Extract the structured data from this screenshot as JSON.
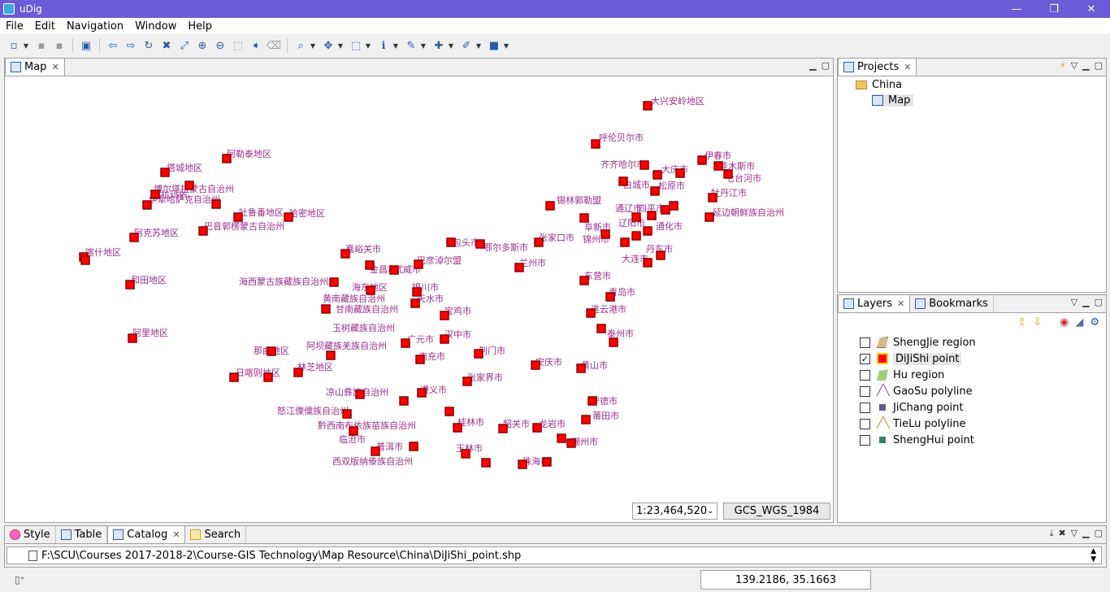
{
  "window": {
    "title": "uDig",
    "min_glyph": "—",
    "restore_glyph": "❐",
    "close_glyph": "✕"
  },
  "menu": [
    "File",
    "Edit",
    "Navigation",
    "Window",
    "Help"
  ],
  "map_view": {
    "tab_label": "Map",
    "scale": "1:23,464,520",
    "crs": "GCS_WGS_1984",
    "point_color": "#ff0000",
    "point_border": "#8b0000",
    "label_color": "#9b2d8e",
    "labels": [
      "大兴安岭地区",
      "呼伦贝尔市",
      "齐齐哈尔市",
      "大庆市",
      "伊春市",
      "佳木斯市",
      "七台河市",
      "牡丹江市",
      "松原市",
      "白城市",
      "延边朝鲜族自治州",
      "锡林郭勒盟",
      "阿勒泰地区",
      "塔城地区",
      "博尔塔拉蒙古自治州",
      "克拉玛依",
      "伊犁哈萨克自治州",
      "吐鲁番地区",
      "哈密地区",
      "巴音郭楞蒙古自治州",
      "阿克苏地区",
      "喀什地区",
      "和田地区",
      "阿里地区",
      "嘉峪关市",
      "金昌市",
      "武威市",
      "海西蒙古族藏族自治州",
      "海东地区",
      "黄南藏族自治州",
      "甘南藏族自治州",
      "玉树藏族自治州",
      "阿坝藏族羌族自治州",
      "那曲地区",
      "日喀则地区",
      "林芝地区",
      "凉山彝族自治州",
      "怒江傈僳族自治州",
      "黔西南布依族苗族自治州",
      "临沧市",
      "普洱市",
      "西双版纳傣族自治州",
      "包头市",
      "鄂尔多斯市",
      "张家口市",
      "锦州市",
      "大连市",
      "丹东市",
      "东营市",
      "青岛市",
      "连云港市",
      "泰州市",
      "宁德市",
      "莆田市",
      "潮州市",
      "珠海市",
      "桂林市",
      "韶关市",
      "龙岩市",
      "玉林市",
      "遵义市",
      "荆门市",
      "安庆市",
      "黄山市",
      "张家界市",
      "通辽市",
      "四平市",
      "通化市",
      "辽阳市",
      "银川市",
      "天水市",
      "广元市",
      "南充市",
      "宝鸡市",
      "汉中市",
      "阜新市",
      "巴彦淖尔盟",
      "兰州市"
    ]
  },
  "projects": {
    "tab_label": "Projects",
    "tree": [
      "China",
      "Map"
    ]
  },
  "layers": {
    "tab_label": "Layers",
    "bookmarks_label": "Bookmarks",
    "items": [
      {
        "name": "ShengJie region",
        "checked": false,
        "icon": "region-icon",
        "color": "#d9b88a"
      },
      {
        "name": "DiJiShi point",
        "checked": true,
        "icon": "point-icon",
        "color": "#ff0000"
      },
      {
        "name": "Hu region",
        "checked": false,
        "icon": "region-icon",
        "color": "#9ed07a"
      },
      {
        "name": "GaoSu polyline",
        "checked": false,
        "icon": "polyline-icon",
        "color": "#8a4a9e"
      },
      {
        "name": "JiChang point",
        "checked": false,
        "icon": "point-icon",
        "color": "#5b5b9b"
      },
      {
        "name": "TieLu polyline",
        "checked": false,
        "icon": "polyline-icon",
        "color": "#d08a2a"
      },
      {
        "name": "ShengHui point",
        "checked": false,
        "icon": "point-icon",
        "color": "#2a8a5a"
      }
    ]
  },
  "bottom_tabs": [
    "Style",
    "Table",
    "Catalog",
    "Search"
  ],
  "catalog": {
    "file_path": "F:\\SCU\\Courses 2017-2018-2\\Course-GIS Technology\\Map Resource\\China\\DiJiShi_point.shp"
  },
  "status": {
    "coordinates": "139.2186, 35.1663"
  }
}
